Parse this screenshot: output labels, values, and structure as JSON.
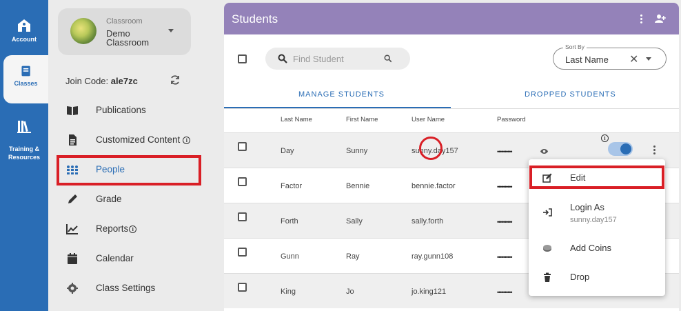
{
  "rail": [
    {
      "label": "Account",
      "icon": "home-icon"
    },
    {
      "label": "Classes",
      "icon": "book-icon"
    },
    {
      "label": "Training &\nResources",
      "icon": "library-icon"
    }
  ],
  "class_card": {
    "kicker": "Classroom",
    "name": "Demo Classroom"
  },
  "join": {
    "prefix": "Join Code:",
    "code": "ale7zc"
  },
  "nav": [
    {
      "label": "Publications",
      "icon": "book-open-icon"
    },
    {
      "label": "Customized Content",
      "icon": "document-icon",
      "info": "i"
    },
    {
      "label": "People",
      "icon": "people-grid-icon"
    },
    {
      "label": "Grade",
      "icon": "pencil-icon"
    },
    {
      "label": "Reports",
      "icon": "trend-icon",
      "info": "i"
    },
    {
      "label": "Calendar",
      "icon": "calendar-icon"
    },
    {
      "label": "Class Settings",
      "icon": "gear-icon"
    }
  ],
  "header": {
    "title": "Students"
  },
  "search": {
    "placeholder": "Find Student"
  },
  "sort": {
    "kicker": "Sort By",
    "value": "Last Name"
  },
  "tabs": [
    "MANAGE STUDENTS",
    "DROPPED STUDENTS"
  ],
  "columns": [
    "Last Name",
    "First Name",
    "User Name",
    "Password"
  ],
  "rows": [
    {
      "last": "Day",
      "first": "Sunny",
      "user": "sunny.day157",
      "password": "••••••••••"
    },
    {
      "last": "Factor",
      "first": "Bennie",
      "user": "bennie.factor",
      "password": "••••••••••"
    },
    {
      "last": "Forth",
      "first": "Sally",
      "user": "sally.forth",
      "password": "••••••••••"
    },
    {
      "last": "Gunn",
      "first": "Ray",
      "user": "ray.gunn108",
      "password": "••••••••••"
    },
    {
      "last": "King",
      "first": "Jo",
      "user": "jo.king121",
      "password": "••••••••••"
    }
  ],
  "row_info": "i",
  "menu": {
    "edit": "Edit",
    "login_as": "Login As",
    "login_sub": "sunny.day157",
    "add_coins": "Add Coins",
    "drop": "Drop"
  },
  "colors": {
    "rail": "#2a6db5",
    "header": "#9482b9",
    "highlight": "#d91f26"
  }
}
